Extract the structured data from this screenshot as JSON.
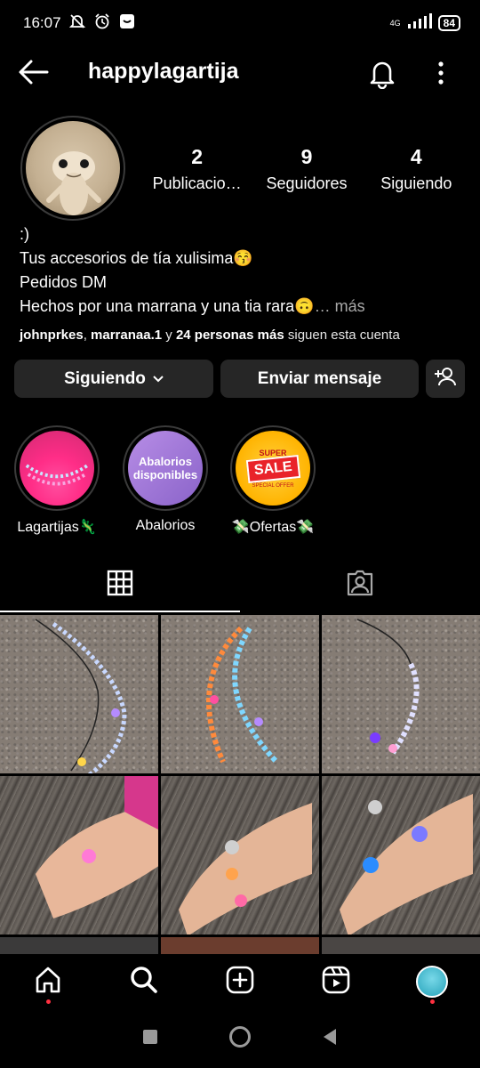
{
  "status": {
    "time": "16:07",
    "network": "4G",
    "battery": "84"
  },
  "header": {
    "username": "happylagartija"
  },
  "stats": [
    {
      "value": "2",
      "label": "Publicacio…"
    },
    {
      "value": "9",
      "label": "Seguidores"
    },
    {
      "value": "4",
      "label": "Siguiendo"
    }
  ],
  "bio": {
    "line1": ":)",
    "line2": "Tus accesorios de tía xulisima😚",
    "line3": "Pedidos DM",
    "line4": "Hechos por una marrana y una tia rara🙃",
    "more": "… más"
  },
  "followers": {
    "user1": "johnprkes",
    "sep": ", ",
    "user2": "marranaa.1",
    "and": " y ",
    "others": "24 personas más",
    "suffix": " siguen esta cuenta"
  },
  "buttons": {
    "following": "Siguiendo",
    "message": "Enviar mensaje"
  },
  "highlights": [
    {
      "label": "Lagartijas🦎"
    },
    {
      "label": "Abalorios",
      "cover_text": "Abalorios disponibles"
    },
    {
      "label": "💸Ofertas💸",
      "cover_text_top": "SUPER",
      "cover_text_main": "SALE",
      "cover_text_bottom": "SPECIAL OFFER"
    }
  ],
  "colors": {
    "background": "#000000",
    "button": "#262626",
    "notification_dot": "#ff3040"
  },
  "icons": [
    "back-arrow-icon",
    "bell-icon",
    "more-vertical-icon",
    "chevron-down-icon",
    "add-person-icon",
    "grid-icon",
    "tagged-icon",
    "home-icon",
    "search-icon",
    "create-icon",
    "reels-icon"
  ]
}
